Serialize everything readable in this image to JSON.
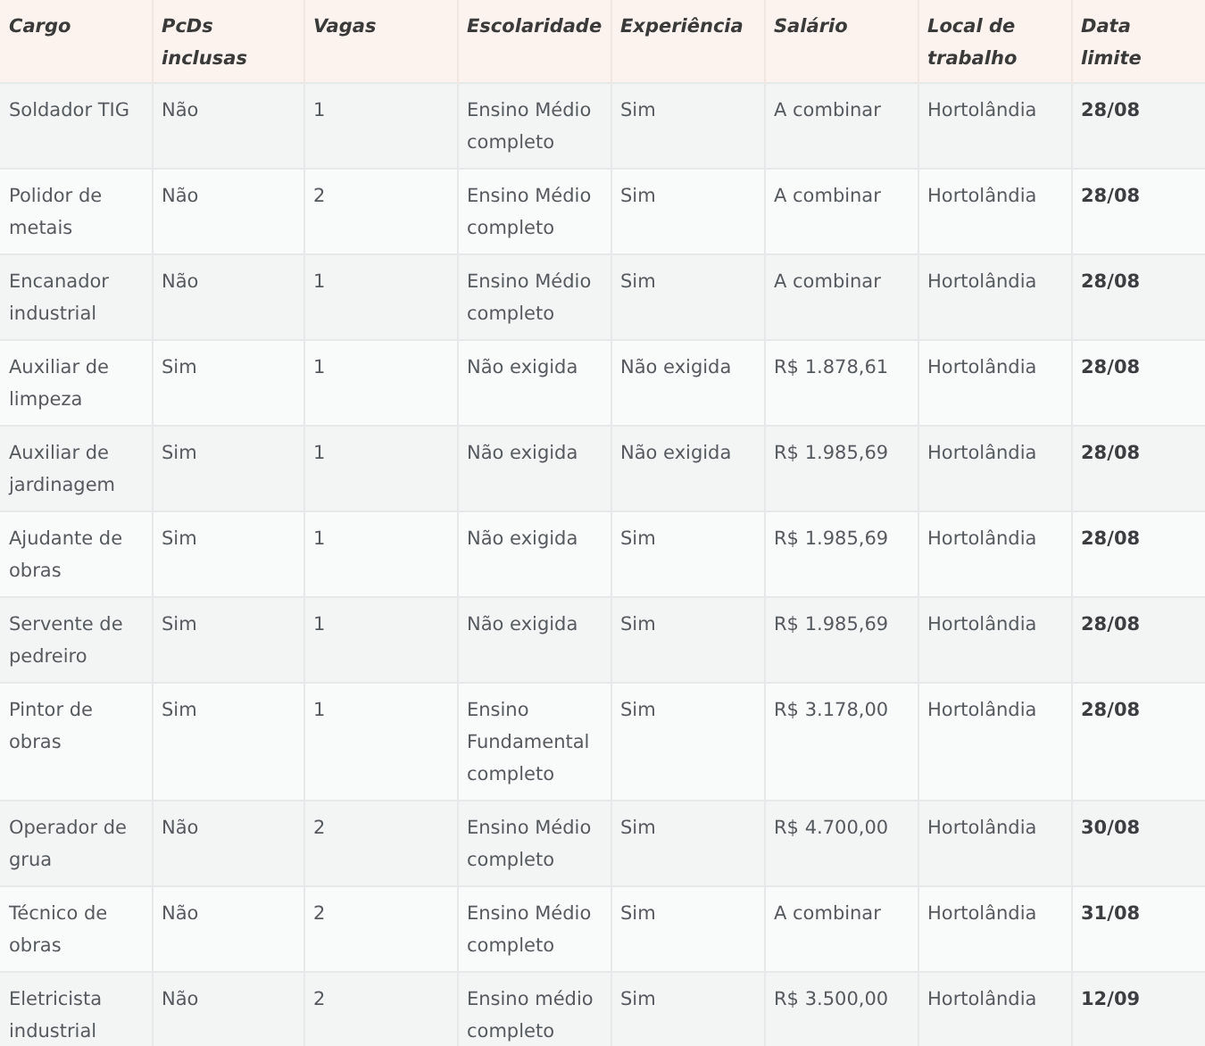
{
  "table": {
    "columns": [
      "Cargo",
      "PcDs inclusas",
      "Vagas",
      "Escolaridade",
      "Experiência",
      "Salário",
      "Local de trabalho",
      "Data limite"
    ],
    "rows": [
      [
        "Soldador TIG",
        "Não",
        "1",
        "Ensino Médio completo",
        "Sim",
        "A combinar",
        "Hortolândia",
        "28/08"
      ],
      [
        "Polidor de metais",
        "Não",
        "2",
        "Ensino Médio completo",
        "Sim",
        "A combinar",
        "Hortolândia",
        "28/08"
      ],
      [
        "Encanador industrial",
        "Não",
        "1",
        "Ensino Médio completo",
        "Sim",
        "A combinar",
        "Hortolândia",
        "28/08"
      ],
      [
        "Auxiliar de limpeza",
        "Sim",
        "1",
        "Não exigida",
        "Não exigida",
        "R$ 1.878,61",
        "Hortolândia",
        "28/08"
      ],
      [
        "Auxiliar de jardinagem",
        "Sim",
        "1",
        "Não exigida",
        "Não exigida",
        "R$ 1.985,69",
        "Hortolândia",
        "28/08"
      ],
      [
        "Ajudante de obras",
        "Sim",
        "1",
        "Não exigida",
        "Sim",
        "R$ 1.985,69",
        "Hortolândia",
        "28/08"
      ],
      [
        "Servente de pedreiro",
        "Sim",
        "1",
        "Não exigida",
        "Sim",
        "R$ 1.985,69",
        "Hortolândia",
        "28/08"
      ],
      [
        "Pintor de obras",
        "Sim",
        "1",
        "Ensino Fundamental completo",
        "Sim",
        "R$ 3.178,00",
        "Hortolândia",
        "28/08"
      ],
      [
        "Operador de grua",
        "Não",
        "2",
        "Ensino Médio completo",
        "Sim",
        "R$ 4.700,00",
        "Hortolândia",
        "30/08"
      ],
      [
        "Técnico de obras",
        "Não",
        "2",
        "Ensino Médio completo",
        "Sim",
        "A combinar",
        "Hortolândia",
        "31/08"
      ],
      [
        "Eletricista industrial",
        "Não",
        "2",
        "Ensino médio completo",
        "Sim",
        "R$ 3.500,00",
        "Hortolândia",
        "12/09"
      ]
    ]
  }
}
